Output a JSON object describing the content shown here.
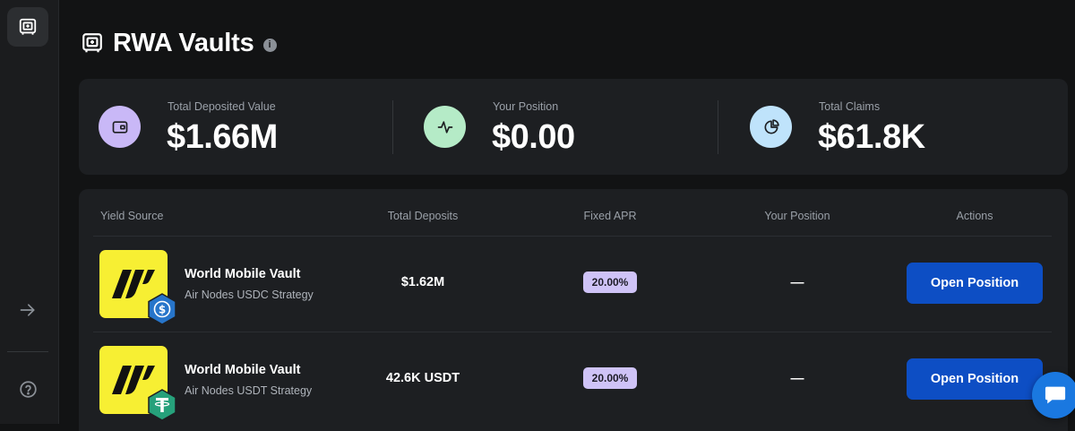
{
  "page": {
    "title": "RWA Vaults",
    "info_glyph": "i"
  },
  "sidebar": {
    "items": [
      {
        "icon": "vault-icon",
        "active": true
      },
      {
        "icon": "arrow-right-icon",
        "active": false
      },
      {
        "icon": "help-icon",
        "active": false
      }
    ]
  },
  "stats": [
    {
      "label": "Total Deposited Value",
      "value": "$1.66M",
      "icon": "wallet-icon",
      "color": "#c9b8f7"
    },
    {
      "label": "Your Position",
      "value": "$0.00",
      "icon": "activity-icon",
      "color": "#b5ebc7"
    },
    {
      "label": "Total Claims",
      "value": "$61.8K",
      "icon": "pie-chart-icon",
      "color": "#bfe3fb"
    }
  ],
  "table": {
    "columns": [
      "Yield Source",
      "Total Deposits",
      "Fixed APR",
      "Your Position",
      "Actions"
    ],
    "rows": [
      {
        "name": "World Mobile Vault",
        "strategy": "Air Nodes USDC Strategy",
        "deposits": "$1.62M",
        "apr": "20.00%",
        "position": "—",
        "action": "Open Position",
        "token_icon": "usdc-icon",
        "token_color": "#2775ca"
      },
      {
        "name": "World Mobile Vault",
        "strategy": "Air Nodes USDT Strategy",
        "deposits": "42.6K USDT",
        "apr": "20.00%",
        "position": "—",
        "action": "Open Position",
        "token_icon": "usdt-icon",
        "token_color": "#26a17b"
      }
    ]
  },
  "colors": {
    "accent": "#0d4ec4",
    "apr_badge": "#cfc3f7",
    "logo_yellow": "#f7ef33",
    "chat": "#1a78e0"
  }
}
